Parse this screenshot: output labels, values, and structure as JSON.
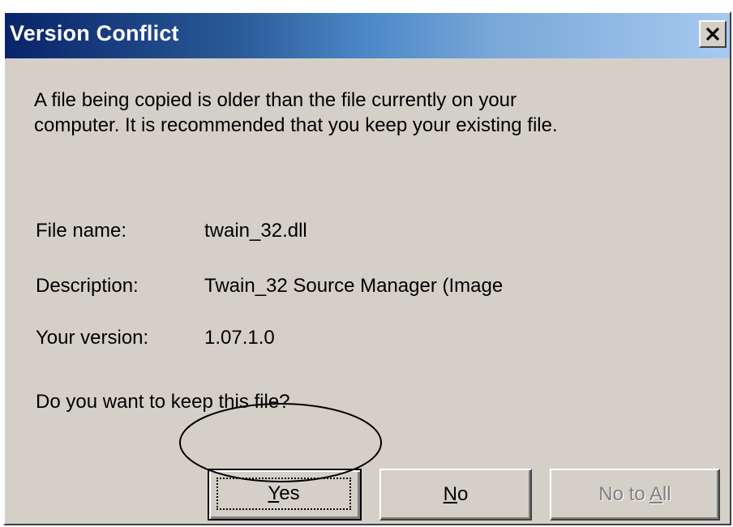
{
  "window": {
    "title": "Version Conflict",
    "close_icon": "close-icon"
  },
  "message": {
    "line1": "A file being copied is older than the file currently on your",
    "line2": "computer. It is recommended that you keep your existing file."
  },
  "details": [
    {
      "label": "File name:",
      "value": "twain_32.dll"
    },
    {
      "label": "Description:",
      "value": "Twain_32 Source Manager (Image"
    },
    {
      "label": "Your version:",
      "value": "1.07.1.0"
    }
  ],
  "question": "Do you want to keep this file?",
  "buttons": {
    "yes": {
      "label": "Yes",
      "mnemonic": "Y",
      "rest": "es",
      "state": "default"
    },
    "no": {
      "label": "No",
      "mnemonic": "N",
      "rest": "o"
    },
    "no_to_all": {
      "label": "No to All",
      "prefix": "No to ",
      "mnemonic": "A",
      "rest": "ll",
      "state": "disabled"
    }
  },
  "colors": {
    "face": "#d4d0c8",
    "title_start": "#0a246a",
    "title_end": "#a6caf0",
    "disabled_text": "#808080"
  }
}
